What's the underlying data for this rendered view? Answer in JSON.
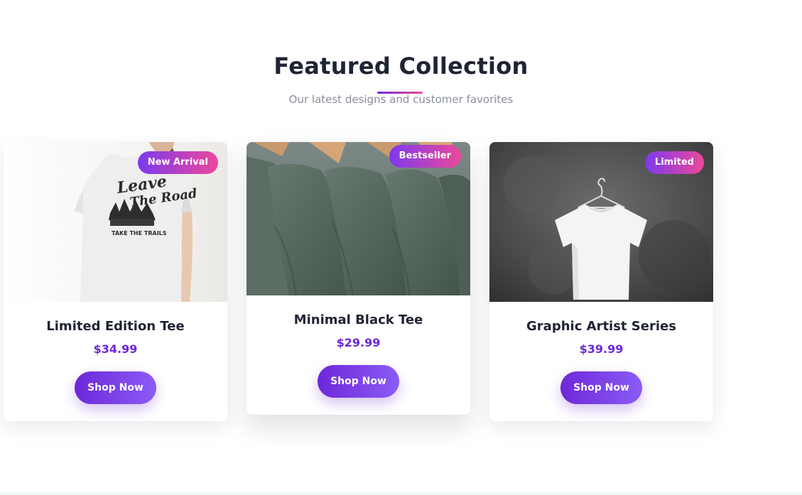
{
  "section": {
    "title": "Featured Collection",
    "subtitle": "Our latest designs and customer favorites",
    "accent_gradient": [
      "#6d28d9",
      "#ec4899"
    ]
  },
  "products": [
    {
      "badge": "New Arrival",
      "name": "Limited Edition Tee",
      "price": "$34.99",
      "button_label": "Shop Now",
      "print_text": [
        "Leave",
        "The Road",
        "TAKE THE TRAILS"
      ]
    },
    {
      "badge": "Bestseller",
      "name": "Minimal Black Tee",
      "price": "$29.99",
      "button_label": "Shop Now"
    },
    {
      "badge": "Limited",
      "name": "Graphic Artist Series",
      "price": "$39.99",
      "button_label": "Shop Now"
    }
  ],
  "colors": {
    "price": "#6d28d9",
    "button_start": "#6d28d9",
    "button_end": "#8b5cf6",
    "badge_start": "#7c3aed",
    "badge_end": "#ec4899"
  }
}
